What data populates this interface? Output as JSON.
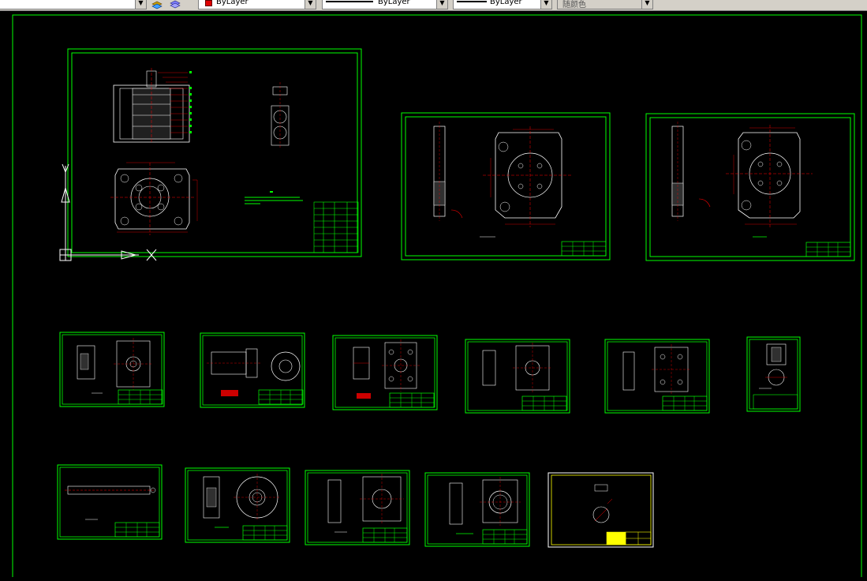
{
  "toolbar": {
    "layer_combo": {
      "value": ""
    },
    "color_combo": {
      "value": "ByLayer",
      "swatch": "#e00000"
    },
    "linetype_combo": {
      "value": "ByLayer"
    },
    "lineweight_combo": {
      "value": "ByLayer"
    },
    "plotstyle_combo": {
      "value": "随颜色"
    }
  },
  "colors": {
    "background": "#000000",
    "frame": "#00ff00",
    "geometry": "#ffffff",
    "centerline": "#ff0000",
    "titleblock_highlight": "#ffff00",
    "ucs": "#ffffff"
  },
  "sheets": [
    {
      "id": "assembly"
    },
    {
      "id": "plate-1"
    },
    {
      "id": "plate-2"
    },
    {
      "id": "part-1"
    },
    {
      "id": "part-2"
    },
    {
      "id": "part-3"
    },
    {
      "id": "part-4"
    },
    {
      "id": "part-5"
    },
    {
      "id": "part-6"
    },
    {
      "id": "part-7"
    },
    {
      "id": "part-8"
    },
    {
      "id": "part-9"
    },
    {
      "id": "part-10"
    },
    {
      "id": "part-11"
    }
  ]
}
